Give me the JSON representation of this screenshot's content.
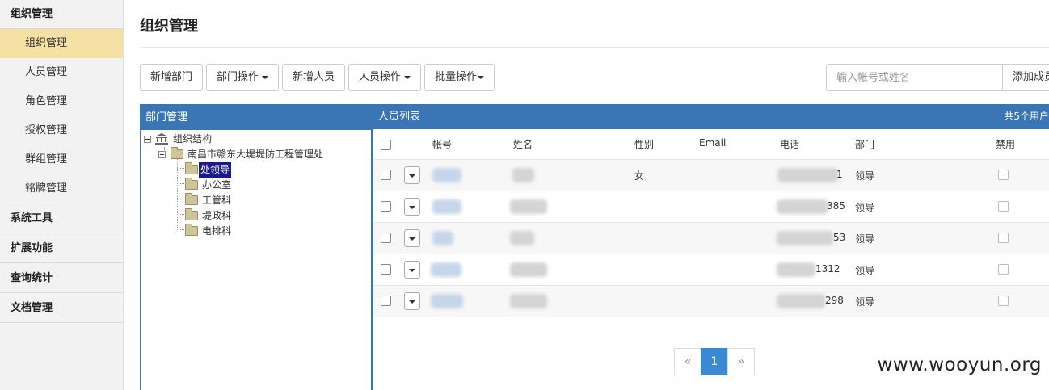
{
  "sidebar": {
    "groups": [
      {
        "label": "组织管理",
        "items": [
          "组织管理",
          "人员管理",
          "角色管理",
          "授权管理",
          "群组管理",
          "铭牌管理"
        ],
        "active_index": 0
      },
      {
        "label": "系统工具"
      },
      {
        "label": "扩展功能"
      },
      {
        "label": "查询统计"
      },
      {
        "label": "文档管理"
      }
    ]
  },
  "main": {
    "title": "组织管理",
    "toolbar": {
      "add_dept": "新增部门",
      "dept_ops": "部门操作",
      "add_person": "新增人员",
      "person_ops": "人员操作",
      "batch_ops": "批量操作"
    },
    "search": {
      "placeholder": "输入帐号或姓名",
      "add_button": "添加成员"
    }
  },
  "dept_panel": {
    "title": "部门管理",
    "tree": {
      "root": "组织结构",
      "org": "南昌市赣东大堤堤防工程管理处",
      "children": [
        "处领导",
        "办公室",
        "工管科",
        "堤政科",
        "电排科"
      ],
      "selected_index": 0
    }
  },
  "people_panel": {
    "title": "人员列表",
    "count": "共5个用户",
    "columns": [
      "帐号",
      "姓名",
      "性别",
      "Email",
      "电话",
      "部门",
      "禁用"
    ],
    "rows": [
      {
        "gender": "女",
        "phone_tail": "1",
        "dept": "领导",
        "name_frag": ""
      },
      {
        "gender": "",
        "phone_tail": "385",
        "dept": "领导",
        "name_frag": ""
      },
      {
        "gender": "",
        "phone_tail": "53",
        "dept": "领导",
        "name_frag": ""
      },
      {
        "gender": "",
        "phone_tail": "1312",
        "dept": "领导",
        "name_frag": ""
      },
      {
        "gender": "",
        "phone_tail": "298",
        "dept": "领导",
        "name_frag": ""
      }
    ],
    "pager": {
      "prev": "«",
      "current": "1",
      "next": "»"
    }
  },
  "watermark": "www.wooyun.org",
  "colors": {
    "accent": "#3a76b5",
    "active_nav": "#f5e1a4",
    "page_active": "#3a8ad3"
  }
}
